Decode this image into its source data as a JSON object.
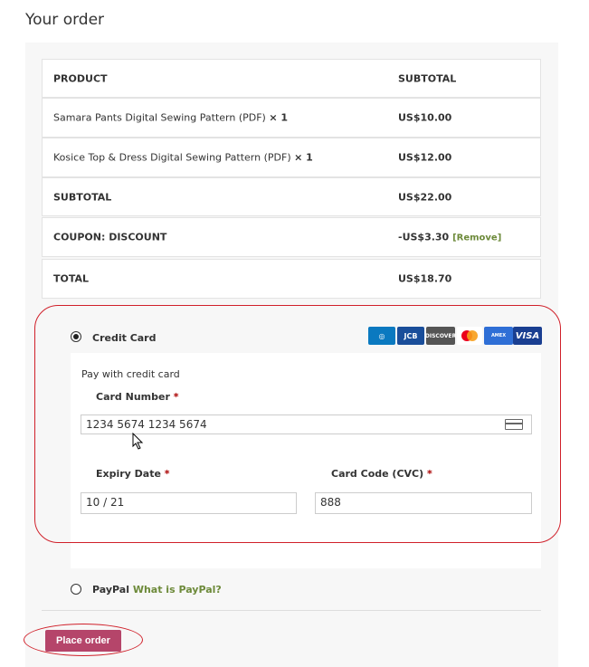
{
  "title": "Your order",
  "table": {
    "headers": [
      "PRODUCT",
      "SUBTOTAL"
    ],
    "items": [
      {
        "name": "Samara Pants Digital Sewing Pattern (PDF)",
        "qty": "× 1",
        "price": "US$10.00"
      },
      {
        "name": "Kosice Top & Dress Digital Sewing Pattern (PDF)",
        "qty": "× 1",
        "price": "US$12.00"
      }
    ],
    "subtotal_label": "SUBTOTAL",
    "subtotal": "US$22.00",
    "coupon_label": "COUPON: DISCOUNT",
    "coupon": "-US$3.30",
    "remove": "[Remove]",
    "total_label": "TOTAL",
    "total": "US$18.70"
  },
  "payment": {
    "credit_card": "Credit Card",
    "cards": [
      "Diners",
      "JCB",
      "DISCOVER",
      "mastercard",
      "AMERICAN EXPRESS",
      "VISA"
    ],
    "desc": "Pay with credit card",
    "card_number_label": "Card Number",
    "req": "*",
    "card_number": "1234 5674 1234 5674",
    "expiry_label": "Expiry Date",
    "expiry": "10 / 21",
    "cvc_label": "Card Code (CVC)",
    "cvc": "888",
    "paypal": "PayPal",
    "paypal_link": "What is PayPal?"
  },
  "place_order": "Place order",
  "colors": {
    "button": "#b5456a",
    "highlight": "#d0202a",
    "link": "#6d8a3a"
  }
}
